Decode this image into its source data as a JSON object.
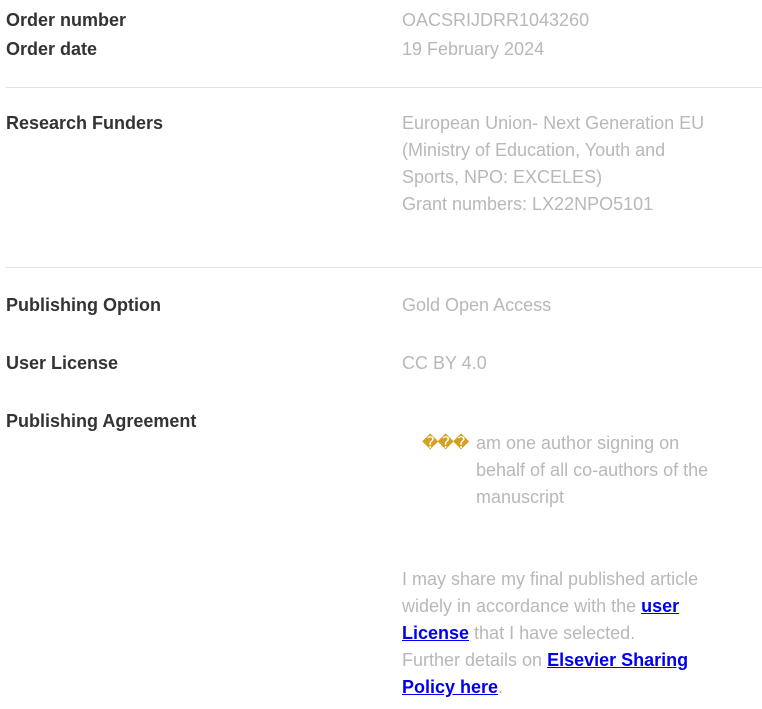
{
  "order": {
    "number_label": "Order number",
    "number_value": "OACSRIJDRR1043260",
    "date_label": "Order date",
    "date_value": "19 February 2024"
  },
  "funders": {
    "label": "Research Funders",
    "line1": "European Union- Next Generation EU",
    "line2": "(Ministry of Education, Youth and",
    "line3": "Sports, NPO: EXCELES)",
    "line4": "Grant numbers: LX22NPO5101"
  },
  "publishing_option": {
    "label": "Publishing Option",
    "value": "Gold Open Access"
  },
  "user_license": {
    "label": "User License",
    "value": "CC BY 4.0"
  },
  "publishing_agreement": {
    "label": "Publishing Agreement",
    "glyph": "���",
    "line1": "am one author signing on",
    "line2": "behalf of all co-authors of the",
    "line3": "manuscript"
  },
  "sharing": {
    "line1": "I may share my final published article",
    "line2_pre": "widely in accordance with the ",
    "user_link": "user",
    "license_link": "License",
    "line3_post": " that I have selected.",
    "line4_pre": "Further details on ",
    "policy_link_1": "Elsevier Sharing",
    "policy_link_2": "Policy here",
    "period": "."
  },
  "colors": {
    "label": "#333333",
    "value": "#b8b8b8",
    "link": "#0000ee",
    "divider": "#e3e3e3"
  }
}
